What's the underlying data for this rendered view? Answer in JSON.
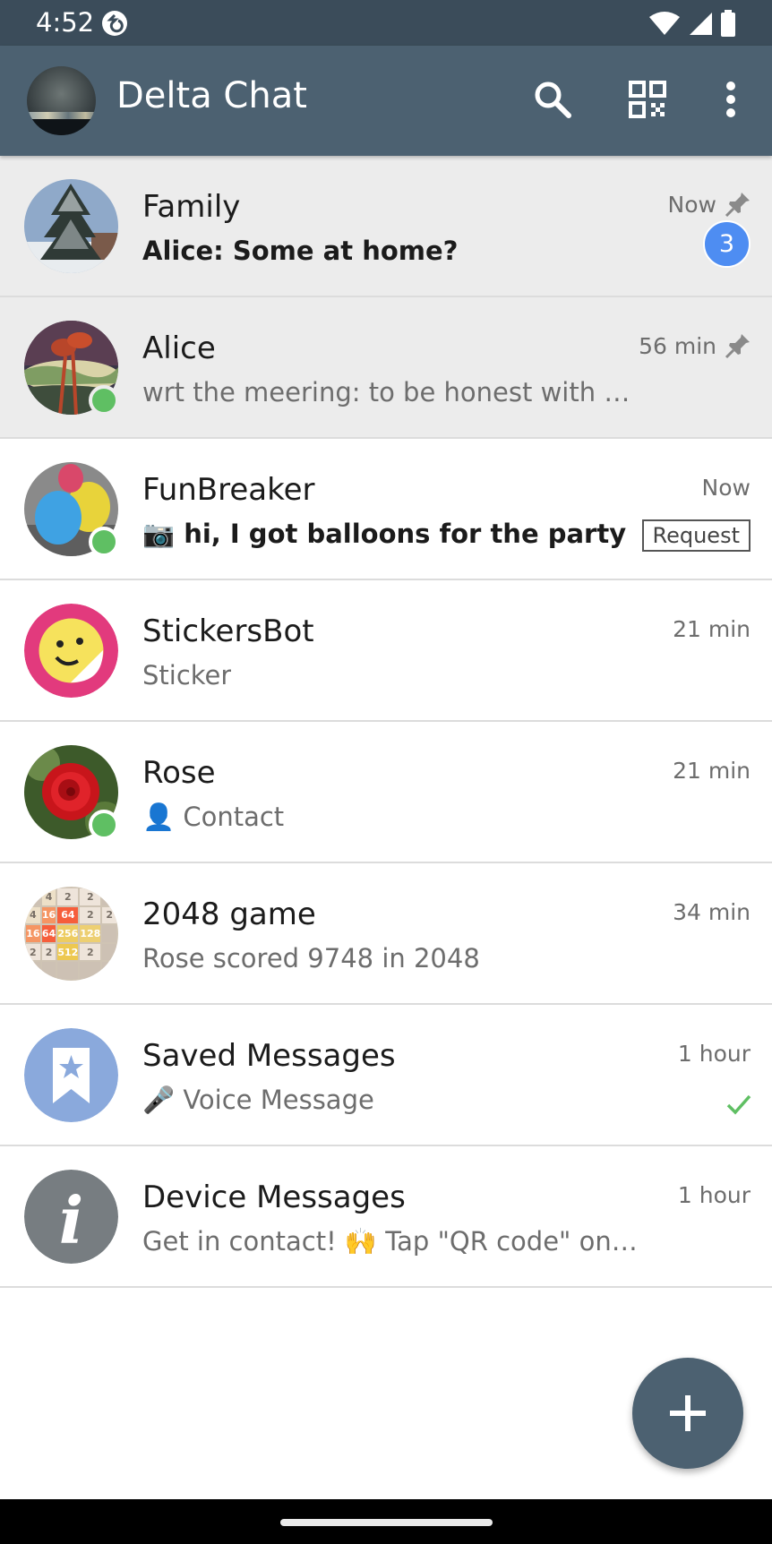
{
  "status_bar": {
    "time": "4:52",
    "icons": [
      "app-notification-icon",
      "wifi-icon",
      "signal-icon",
      "battery-icon"
    ]
  },
  "app_bar": {
    "title": "Delta Chat",
    "actions": [
      "search-icon",
      "qr-code-icon",
      "more-options-icon"
    ]
  },
  "chats": [
    {
      "name": "Family",
      "preview": "Alice: Some at home?",
      "time": "Now",
      "pinned": true,
      "unread_count": "3",
      "online": false,
      "unread": true
    },
    {
      "name": "Alice",
      "preview": "wrt the meering: to be honest with …",
      "time": "56 min",
      "pinned": true,
      "online": true
    },
    {
      "name": "FunBreaker",
      "preview_icon": "📷",
      "preview": "hi, I got balloons for the party",
      "time": "Now",
      "tag": "Request",
      "online": true,
      "unread": true
    },
    {
      "name": "StickersBot",
      "preview": "Sticker",
      "time": "21 min"
    },
    {
      "name": "Rose",
      "preview_icon": "👤",
      "preview": "Contact",
      "time": "21 min",
      "online": true
    },
    {
      "name": "2048 game",
      "preview": "Rose scored 9748 in 2048",
      "time": "34 min"
    },
    {
      "name": "Saved Messages",
      "preview_icon": "🎤",
      "preview": "Voice Message",
      "time": "1 hour",
      "delivered": true
    },
    {
      "name": "Device Messages",
      "preview": "Get in contact! 🙌 Tap \"QR code\" on th…",
      "time": "1 hour"
    }
  ],
  "avatar_2048_tiles": [
    "",
    "4",
    "2",
    "2",
    "",
    "4",
    "16",
    "64",
    "2",
    "2",
    "16",
    "64",
    "256",
    "128",
    "",
    "2",
    "2",
    "512",
    "2",
    "",
    "",
    "",
    "",
    "",
    ""
  ],
  "fab": {
    "icon": "plus-icon"
  },
  "colors": {
    "app_bar": "#4c6171",
    "status_bar": "#3b4c5a",
    "badge": "#4e8df2",
    "online": "#5fbf63",
    "pinned_row": "#ececec"
  }
}
